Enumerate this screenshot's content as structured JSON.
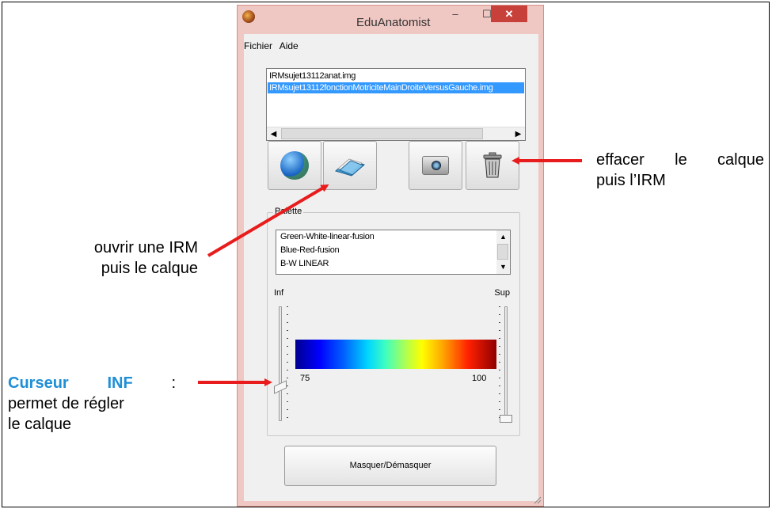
{
  "window": {
    "title": "EduAnatomist"
  },
  "menu": [
    "Fichier",
    "Aide"
  ],
  "files": [
    "IRMsujet13112anat.img",
    "IRMsujet13112fonctionMotriciteMainDroiteVersusGauche.img"
  ],
  "palette": {
    "label": "Palette",
    "items": [
      "Green-White-linear-fusion",
      "Blue-Red-fusion",
      "B-W LINEAR"
    ]
  },
  "sliders": {
    "inf_label": "Inf",
    "sup_label": "Sup",
    "min_value": "75",
    "max_value": "100"
  },
  "buttons": {
    "mask": "Masquer/Démasquer"
  },
  "annotations": {
    "erase_line1": "effacer le calque",
    "erase_line2": "puis l’IRM",
    "open_line1": "ouvrir une IRM",
    "open_line2": "puis le calque",
    "cursor_label": "Curseur",
    "cursor_name": "INF",
    "cursor_colon": " :",
    "cursor_line2": "permet de régler",
    "cursor_line3": "le calque"
  },
  "colors": {
    "arrow": "#e81c1c",
    "highlight": "#1f8fd6",
    "close_button": "#c7413a",
    "selection": "#3399ff"
  },
  "icons": [
    "app-icon",
    "globe-icon",
    "folder-icon",
    "camera-icon",
    "trash-icon",
    "minimize-icon",
    "maximize-icon",
    "close-icon"
  ]
}
